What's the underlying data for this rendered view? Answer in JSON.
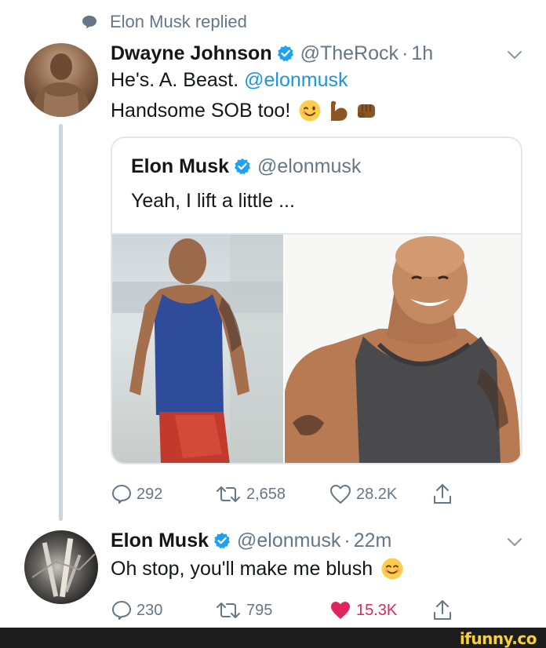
{
  "context": {
    "replied_text": "Elon Musk replied"
  },
  "reply_tweet": {
    "name": "Dwayne Johnson",
    "handle": "@TheRock",
    "separator": "·",
    "time": "1h",
    "line1_prefix": "He's. A. Beast.",
    "line1_mention": "@elonmusk",
    "line2": "Handsome SOB too!",
    "emojis": [
      "winking-face",
      "flexed-biceps",
      "oncoming-fist"
    ]
  },
  "quoted_tweet": {
    "name": "Elon Musk",
    "handle": "@elonmusk",
    "text": "Yeah, I lift a little ..."
  },
  "reply_actions": {
    "replies": "292",
    "retweets": "2,658",
    "likes": "28.2K",
    "liked": false
  },
  "elon_tweet": {
    "name": "Elon Musk",
    "handle": "@elonmusk",
    "separator": "·",
    "time": "22m",
    "text": "Oh stop, you'll make me blush",
    "emoji": "smiling-face-blushing"
  },
  "elon_actions": {
    "replies": "230",
    "retweets": "795",
    "likes": "15.3K",
    "liked": true
  },
  "watermark": {
    "text": "ifunny.co"
  },
  "colors": {
    "text": "#14171a",
    "secondary": "#657786",
    "link": "#1b95e0",
    "verified": "#1da1f2",
    "like": "#e0245e",
    "thread_line": "#ccd6dd"
  }
}
